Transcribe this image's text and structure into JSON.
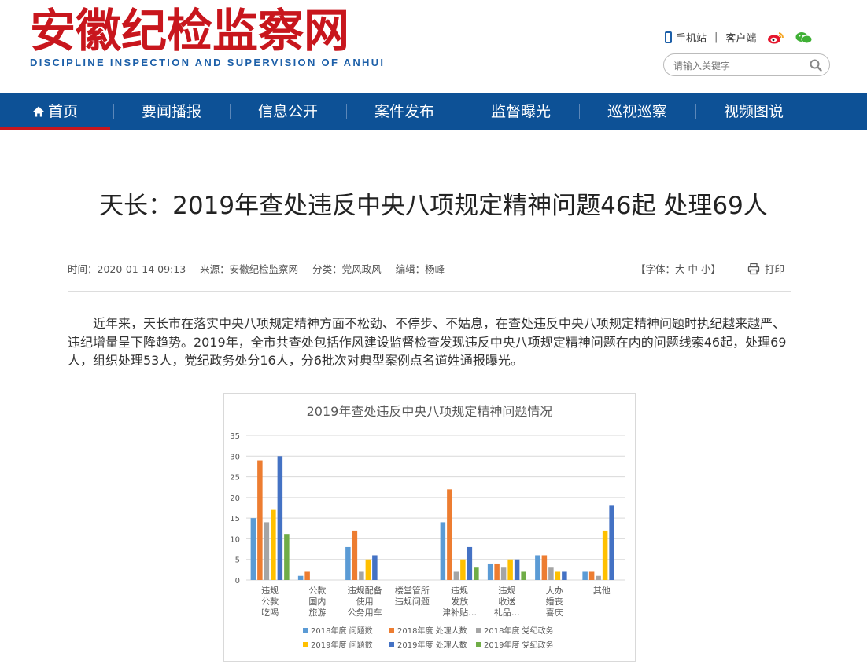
{
  "site": {
    "logo_cn": "安徽纪检监察网",
    "logo_en": "DISCIPLINE INSPECTION AND SUPERVISION OF ANHUI",
    "mobile_link": "手机站",
    "separator": "|",
    "client_link": "客户端",
    "search_placeholder": "请输入关键字",
    "brand_color": "#c8161d",
    "nav_color": "#0d5196"
  },
  "nav": {
    "items": [
      "首页",
      "要闻播报",
      "信息公开",
      "案件发布",
      "监督曝光",
      "巡视巡察",
      "视频图说"
    ],
    "active": "首页"
  },
  "article": {
    "title": "天长：2019年查处违反中央八项规定精神问题46起 处理69人",
    "time": "时间：2020-01-14 09:13",
    "source": "来源：安徽纪检监察网",
    "category": "分类：党风政风",
    "editor": "编辑：杨峰",
    "font_size_label": "【字体：大 中 小】",
    "print_label": "打印",
    "paragraph": "近年来，天长市在落实中央八项规定精神方面不松劲、不停步、不姑息，在查处违反中央八项规定精神问题时执纪越来越严、违纪增量呈下降趋势。2019年，全市共查处包括作风建设监督检查发现违反中央八项规定精神问题在内的问题线索46起，处理69人，组织处理53人，党纪政务处分16人，分6批次对典型案例点名道姓通报曝光。"
  },
  "chart_data": {
    "type": "bar",
    "title": "2019年查处违反中央八项规定精神问题情况",
    "ylim": [
      0,
      35
    ],
    "yticks": [
      0,
      5,
      10,
      15,
      20,
      25,
      30,
      35
    ],
    "categories": [
      [
        "违规",
        "公款",
        "吃喝"
      ],
      [
        "公款",
        "国内",
        "旅游"
      ],
      [
        "违规配备",
        "使用",
        "公务用车"
      ],
      [
        "楼堂管所",
        "违规问题"
      ],
      [
        "违规",
        "发放",
        "津补贴…"
      ],
      [
        "违规",
        "收送",
        "礼品…"
      ],
      [
        "大办",
        "婚丧",
        "喜庆"
      ],
      [
        "其他"
      ]
    ],
    "series": [
      {
        "name": "2018年度 问题数",
        "color": "#5b9bd5",
        "values": [
          15,
          1,
          8,
          0,
          14,
          4,
          6,
          2
        ]
      },
      {
        "name": "2018年度 处理人数",
        "color": "#ed7d31",
        "values": [
          29,
          2,
          12,
          0,
          22,
          4,
          6,
          2
        ]
      },
      {
        "name": "2018年度 党纪政务",
        "color": "#a5a5a5",
        "values": [
          14,
          0,
          2,
          0,
          2,
          3,
          3,
          1
        ]
      },
      {
        "name": "2019年度 问题数",
        "color": "#ffc000",
        "values": [
          17,
          0,
          5,
          0,
          5,
          5,
          2,
          12
        ]
      },
      {
        "name": "2019年度 处理人数",
        "color": "#4472c4",
        "values": [
          30,
          0,
          6,
          0,
          8,
          5,
          2,
          18
        ]
      },
      {
        "name": "2019年度 党纪政务",
        "color": "#70ad47",
        "values": [
          11,
          0,
          0,
          0,
          3,
          2,
          0,
          0
        ]
      }
    ],
    "grid": true,
    "legend": "bottom"
  }
}
